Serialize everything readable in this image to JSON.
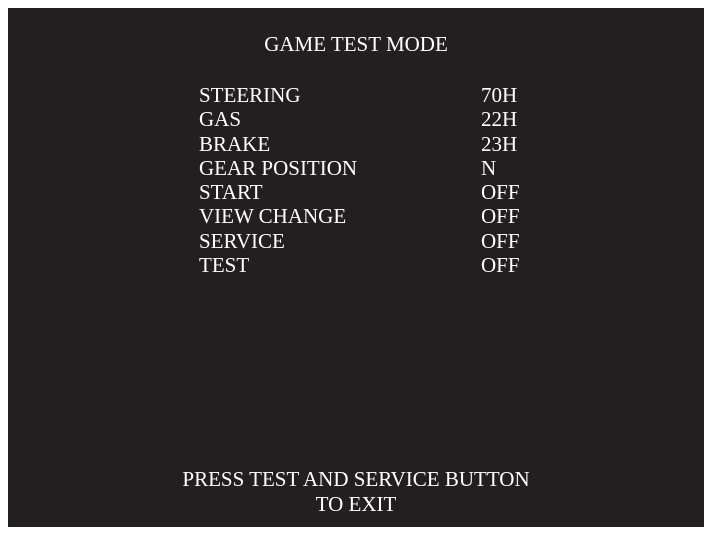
{
  "screen": {
    "title": "GAME TEST MODE",
    "rows": [
      {
        "label": "STEERING",
        "value": "70H"
      },
      {
        "label": "GAS",
        "value": "22H"
      },
      {
        "label": "BRAKE",
        "value": "23H"
      },
      {
        "label": "GEAR POSITION",
        "value": "N"
      },
      {
        "label": "START",
        "value": "OFF"
      },
      {
        "label": "VIEW CHANGE",
        "value": "OFF"
      },
      {
        "label": "SERVICE",
        "value": "OFF"
      },
      {
        "label": "TEST",
        "value": "OFF"
      }
    ],
    "footer_line1": "PRESS TEST AND SERVICE BUTTON",
    "footer_line2": "TO EXIT"
  },
  "colors": {
    "background": "#231f20",
    "text": "#ffffff",
    "frame": "#ffffff"
  }
}
